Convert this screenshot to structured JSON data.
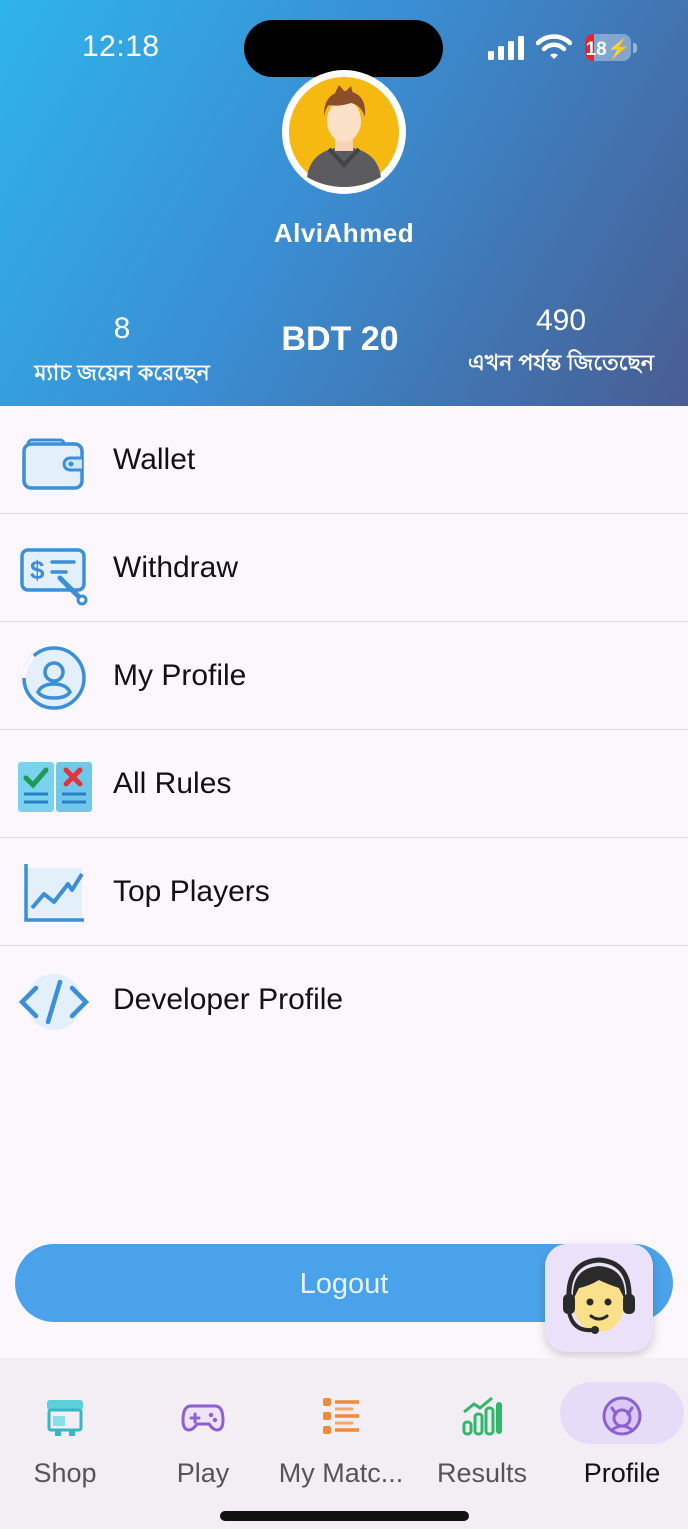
{
  "status_bar": {
    "time": "12:18",
    "battery": "18"
  },
  "profile": {
    "username": "AlviAhmed"
  },
  "stats": {
    "matches_joined": {
      "value": "8",
      "label": "ম্যাচ জয়েন করেছেন"
    },
    "balance": "BDT 20",
    "total_won": {
      "value": "490",
      "label": "এখন পর্যন্ত জিতেছেন"
    }
  },
  "menu": {
    "items": [
      {
        "label": "Wallet",
        "icon": "wallet-icon"
      },
      {
        "label": "Withdraw",
        "icon": "withdraw-icon"
      },
      {
        "label": "My Profile",
        "icon": "user-icon"
      },
      {
        "label": "All Rules",
        "icon": "rules-icon"
      },
      {
        "label": "Top Players",
        "icon": "chart-icon"
      },
      {
        "label": "Developer Profile",
        "icon": "code-icon"
      }
    ]
  },
  "logout_label": "Logout",
  "support_icon": "support-agent-icon",
  "tabs": [
    {
      "label": "Shop",
      "icon": "shop-icon"
    },
    {
      "label": "Play",
      "icon": "gamepad-icon"
    },
    {
      "label": "My Matc...",
      "icon": "list-icon"
    },
    {
      "label": "Results",
      "icon": "results-icon"
    },
    {
      "label": "Profile",
      "icon": "profile-icon",
      "active": true
    }
  ],
  "colors": {
    "header_start": "#2fb4ea",
    "header_end": "#485d92",
    "logout": "#4aa3ea",
    "icon_blue": "#3b8fd9",
    "active_pill": "#e7dcf7"
  }
}
